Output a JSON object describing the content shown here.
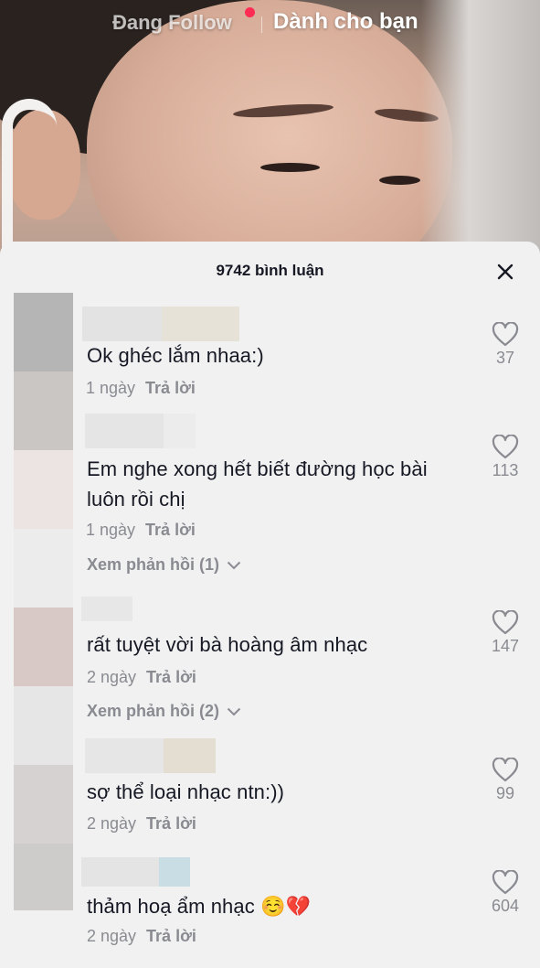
{
  "top_nav": {
    "following_label": "Đang Follow",
    "for_you_label": "Dành cho bạn",
    "notification_dot_color": "#fe2c55"
  },
  "sheet": {
    "title": "9742 bình luận",
    "close_icon": "close-icon"
  },
  "comments": [
    {
      "text": "Ok ghéc lắm nhaa:)",
      "time": "1 ngày",
      "reply_label": "Trả lời",
      "likes": "37",
      "view_replies": null
    },
    {
      "text": "Em nghe xong hết biết đường học bài luôn rồi chị",
      "time": "1 ngày",
      "reply_label": "Trả lời",
      "likes": "113",
      "view_replies": "Xem phản hồi (1)"
    },
    {
      "text": "rất tuyệt vời bà hoàng âm nhạc",
      "time": "2 ngày",
      "reply_label": "Trả lời",
      "likes": "147",
      "view_replies": "Xem phản hồi (2)"
    },
    {
      "text": "sợ thể loại nhạc ntn:))",
      "time": "2 ngày",
      "reply_label": "Trả lời",
      "likes": "99",
      "view_replies": null
    },
    {
      "text": "thảm hoạ ẩm nhạc ☺️💔",
      "time": "2 ngày",
      "reply_label": "Trả lời",
      "likes": "604",
      "view_replies": null
    }
  ],
  "colors": {
    "text_primary": "#161823",
    "text_secondary": "#8a8b91",
    "sheet_background": "#f1f1f2"
  }
}
